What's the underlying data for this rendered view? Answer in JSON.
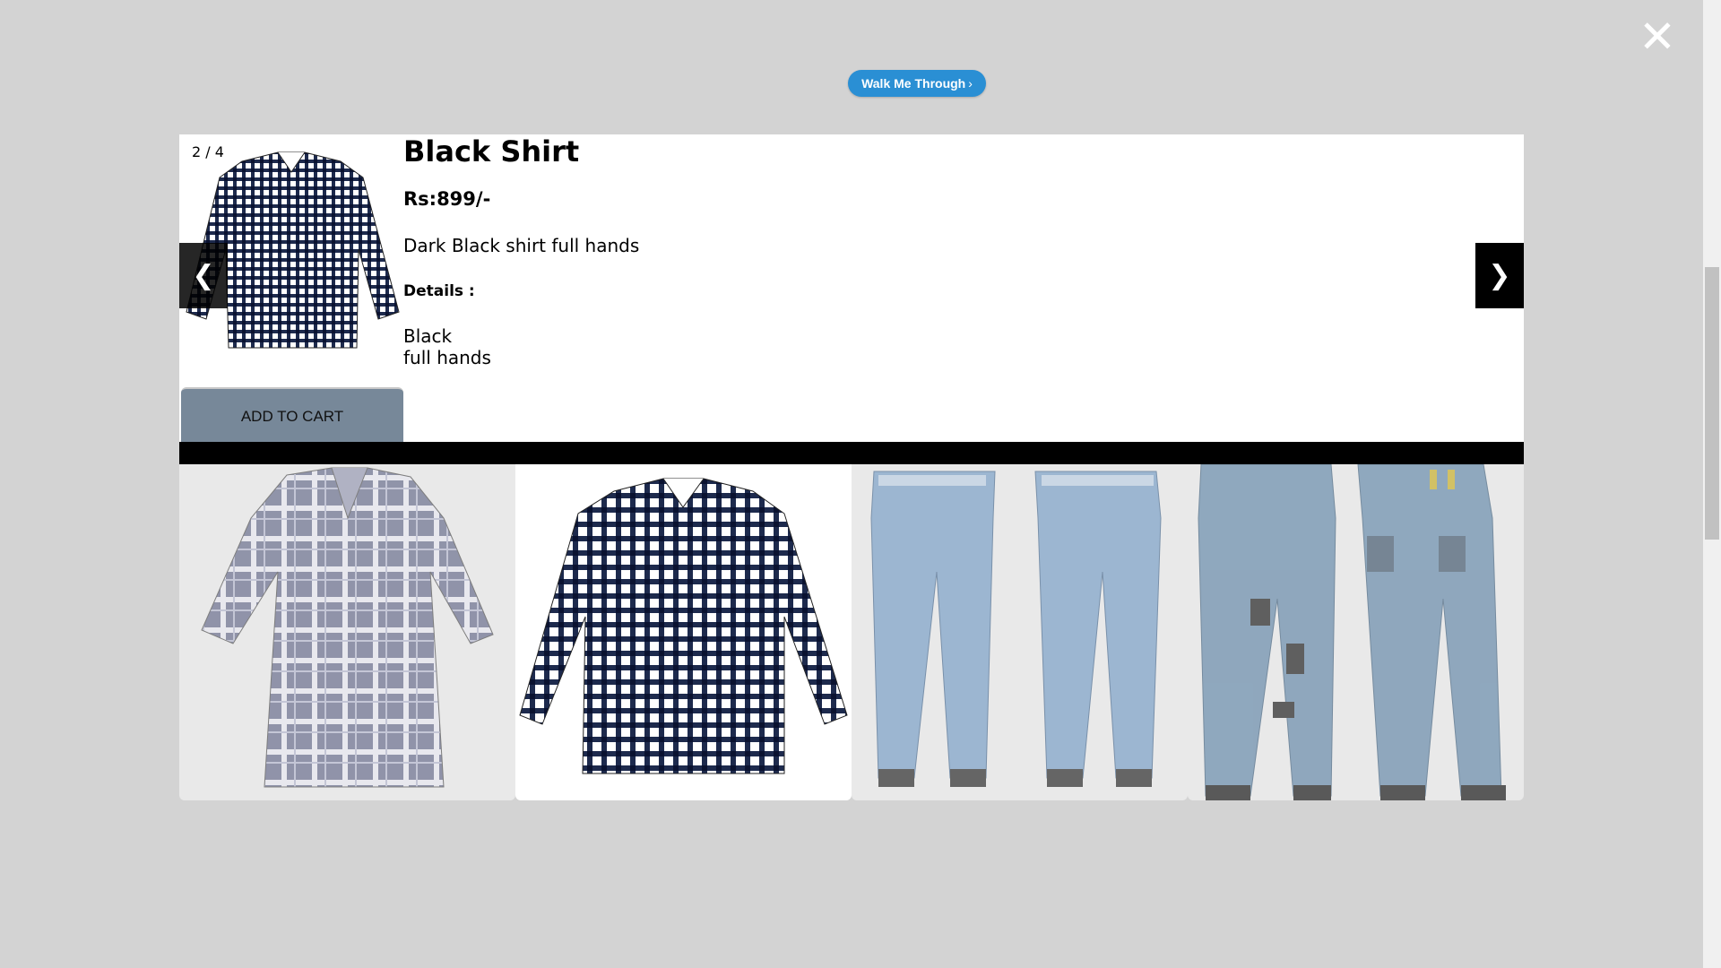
{
  "walk_button": {
    "label": "Walk Me Through",
    "chevron": "›"
  },
  "close_icon": "✕",
  "product": {
    "counter": "2 / 4",
    "title": "Black Shirt",
    "price": "Rs:899/-",
    "description": "Dark Black shirt full hands",
    "details_label": "Details :",
    "details_lines": [
      "Black",
      "full hands"
    ],
    "add_to_cart_label": "ADD TO CART"
  },
  "nav": {
    "prev": "❮",
    "next": "❯"
  },
  "thumbnails": [
    {
      "name": "checked-shirt-purple",
      "icon": "shirt-icon",
      "active": false
    },
    {
      "name": "checked-shirt-black",
      "icon": "shirt-icon",
      "active": true
    },
    {
      "name": "cargo-jeans",
      "icon": "jeans-icon",
      "active": false
    },
    {
      "name": "ripped-jeans",
      "icon": "jeans-icon",
      "active": false
    }
  ],
  "colors": {
    "walk_button": "#2a8fd4",
    "add_to_cart": "#778899",
    "overlay": "#d3d3d3"
  }
}
